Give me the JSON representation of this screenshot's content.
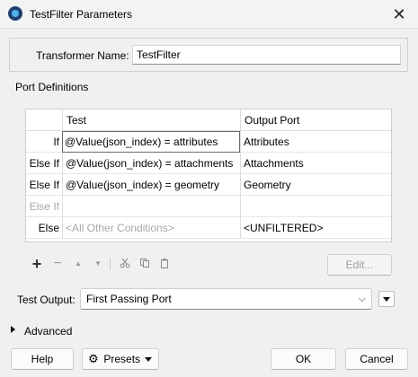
{
  "window": {
    "title": "TestFilter Parameters"
  },
  "transformer": {
    "label": "Transformer Name:",
    "value": "TestFilter"
  },
  "ports": {
    "group_title": "Port Definitions",
    "columns": [
      "Test",
      "Output Port"
    ],
    "rows": [
      {
        "label": "If",
        "test": "@Value(json_index) = attributes",
        "port": "Attributes"
      },
      {
        "label": "Else If",
        "test": "@Value(json_index) = attachments",
        "port": "Attachments"
      },
      {
        "label": "Else If",
        "test": "@Value(json_index) = geometry",
        "port": "Geometry"
      },
      {
        "label": "Else If",
        "test": "",
        "port": ""
      },
      {
        "label": "Else",
        "test": "<All Other Conditions>",
        "port": "<UNFILTERED>"
      }
    ],
    "toolbar": {
      "add": "+",
      "remove": "−",
      "up": "▲",
      "down": "▼"
    },
    "edit_label": "Edit..."
  },
  "test_output": {
    "label": "Test Output:",
    "value": "First Passing Port"
  },
  "advanced": {
    "label": "Advanced"
  },
  "buttons": {
    "help": "Help",
    "presets": "Presets",
    "ok": "OK",
    "cancel": "Cancel"
  }
}
